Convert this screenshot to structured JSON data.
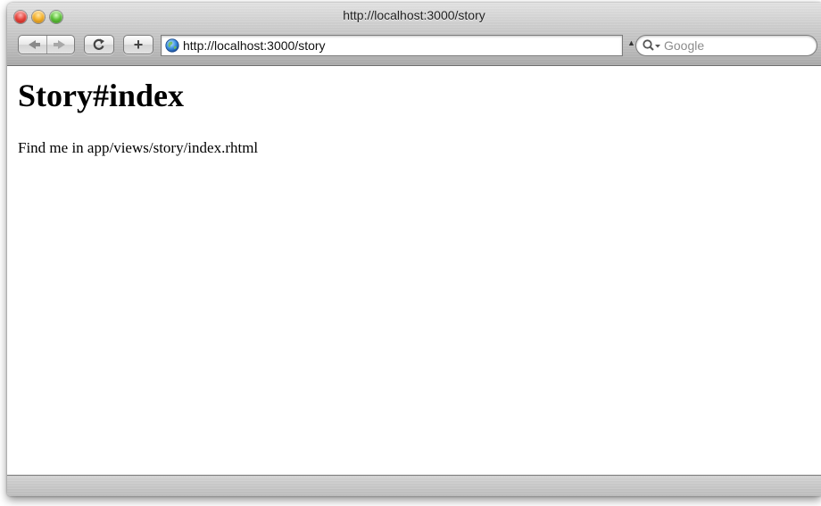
{
  "window": {
    "title": "http://localhost:3000/story"
  },
  "toolbar": {
    "back_icon": "back-arrow-icon",
    "forward_icon": "forward-arrow-icon",
    "reload_glyph": "C",
    "add_glyph": "+",
    "url": "http://localhost:3000/story",
    "search_placeholder": "Google"
  },
  "page": {
    "heading": "Story#index",
    "text": "Find me in app/views/story/index.rhtml"
  }
}
